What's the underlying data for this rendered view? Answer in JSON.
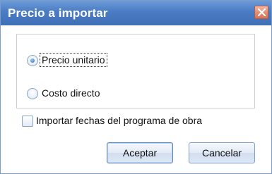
{
  "window": {
    "title": "Precio a importar",
    "close_icon": "close-icon"
  },
  "price_group": {
    "options": [
      {
        "label": "Precio unitario",
        "checked": true
      },
      {
        "label": "Costo directo",
        "checked": false
      }
    ]
  },
  "import_dates": {
    "label": "Importar fechas del programa de obra",
    "checked": false
  },
  "buttons": {
    "accept_label": "Aceptar",
    "cancel_label": "Cancelar"
  },
  "colors": {
    "titlebar": "#4a7cc4",
    "close_button": "#e28f74",
    "button_border": "#7b9ecb"
  }
}
